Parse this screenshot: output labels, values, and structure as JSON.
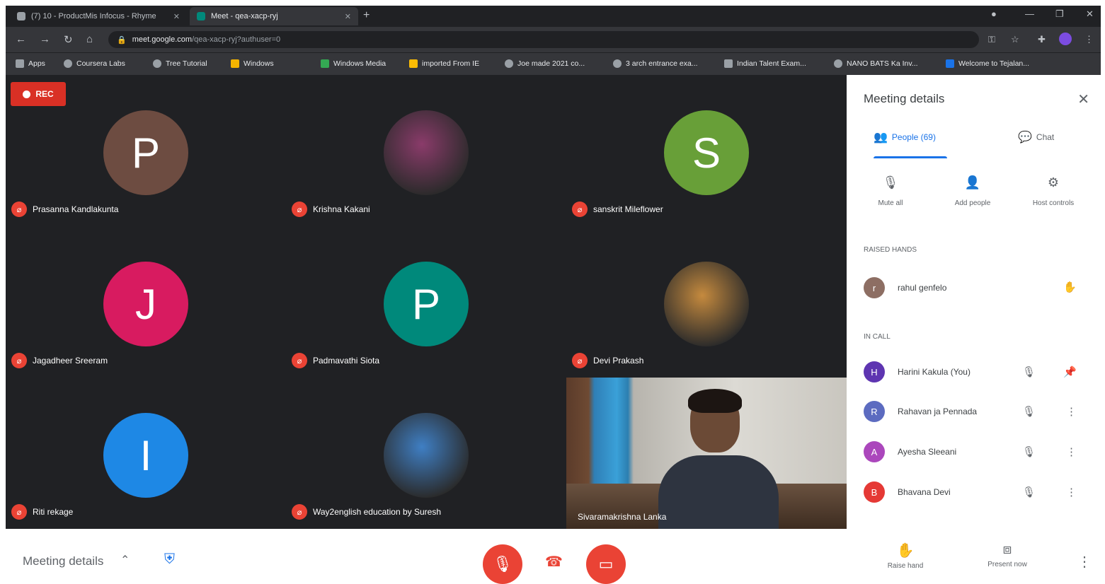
{
  "browser": {
    "tabs": [
      {
        "title": "(7) 10 - ProductMis Infocus - Rhyme",
        "active": false
      },
      {
        "title": "Meet - qea-xacp-ryj",
        "active": true
      }
    ],
    "new_tab": "+",
    "url_host": "meet.google.com",
    "url_path": "/qea-xacp-ryj?authuser=0",
    "bookmarks": [
      "Apps",
      "Coursera Labs",
      "Tree Tutorial",
      "Windows",
      "Windows Media",
      "imported From IE",
      "Joe made 2021 co...",
      "3 arch entrance exa...",
      "Indian Talent Exam...",
      "NANO BATS Ka Inv...",
      "Welcome to Tejalan..."
    ]
  },
  "meeting": {
    "rec_label": "REC",
    "tiles": [
      {
        "initial": "P",
        "name": "Prasanna Kandlakunta",
        "color": "#6d4c41",
        "photo": false
      },
      {
        "initial": "",
        "name": "Krishna Kakani",
        "color": "#8a3b6a",
        "photo": true
      },
      {
        "initial": "S",
        "name": "sanskrit Mileflower",
        "color": "#689f38",
        "photo": false
      },
      {
        "initial": "J",
        "name": "Jagadheer Sreeram",
        "color": "#d81b60",
        "photo": false
      },
      {
        "initial": "P",
        "name": "Padmavathi Siota",
        "color": "#00897b",
        "photo": false
      },
      {
        "initial": "",
        "name": "Devi Prakash",
        "color": "#c58a3e",
        "photo": true
      },
      {
        "initial": "I",
        "name": "Riti rekage",
        "color": "#1e88e5",
        "photo": false
      },
      {
        "initial": "",
        "name": "Way2english education by Suresh",
        "color": "#3f7fc4",
        "photo": true
      }
    ],
    "presenter": {
      "name": "Sivaramakrishna Lanka"
    }
  },
  "panel": {
    "title": "Meeting details",
    "tabs": {
      "people": "People (69)",
      "chat": "Chat"
    },
    "actions": {
      "mute_all": "Mute all",
      "add_people": "Add people",
      "host_controls": "Host controls"
    },
    "raised_hands_label": "RAISED HANDS",
    "raised": [
      {
        "name": "rahul genfelo",
        "initial": "r",
        "color": "#8d6e63"
      }
    ],
    "in_call_label": "IN CALL",
    "people": [
      {
        "name": "Harini Kakula (You)",
        "initial": "H",
        "color": "#5e35b1"
      },
      {
        "name": "Rahavan ja Pennada",
        "initial": "R",
        "color": "#5c6bc0"
      },
      {
        "name": "Ayesha Sleeani",
        "initial": "A",
        "color": "#ab47bc"
      },
      {
        "name": "Bhavana Devi",
        "initial": "B",
        "color": "#e53935"
      }
    ]
  },
  "bottom": {
    "meeting_details": "Meeting details",
    "raise_hand": "Raise hand",
    "present_now": "Present now"
  }
}
